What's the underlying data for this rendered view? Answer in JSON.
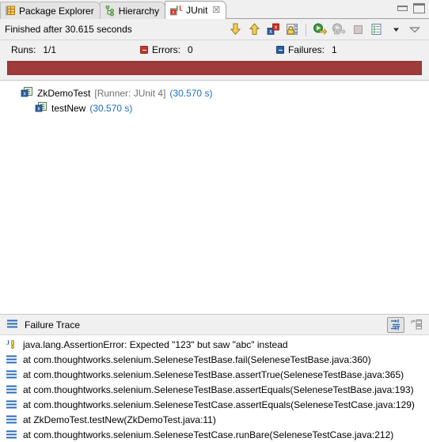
{
  "window": {
    "minimize_label": "Minimize",
    "maximize_label": "Maximize"
  },
  "tabs": [
    {
      "label": "Package Explorer",
      "icon": "package-explorer-icon",
      "active": false,
      "closable": false
    },
    {
      "label": "Hierarchy",
      "icon": "hierarchy-icon",
      "active": false,
      "closable": false
    },
    {
      "label": "JUnit",
      "icon": "junit-icon",
      "active": true,
      "closable": true,
      "close_glyph": "☒"
    }
  ],
  "status": {
    "text": "Finished after 30.615 seconds"
  },
  "toolbar": {
    "items": [
      {
        "name": "next-failure-icon",
        "tooltip": "Next Failed Test"
      },
      {
        "name": "previous-failure-icon",
        "tooltip": "Previous Failed Test"
      },
      {
        "name": "show-failures-only-icon",
        "tooltip": "Show Failures Only"
      },
      {
        "name": "scroll-lock-icon",
        "tooltip": "Scroll Lock"
      },
      {
        "name": "rerun-test-icon",
        "tooltip": "Rerun Test"
      },
      {
        "name": "rerun-failed-tests-icon",
        "tooltip": "Rerun Test - Failures First"
      },
      {
        "name": "stop-icon",
        "tooltip": "Stop JUnit Test Run"
      },
      {
        "name": "test-run-history-icon",
        "tooltip": "Test Run History"
      },
      {
        "name": "history-dropdown-icon",
        "tooltip": "Test Run History Menu"
      },
      {
        "name": "view-menu-icon",
        "tooltip": "View Menu"
      }
    ]
  },
  "counters": {
    "runs": {
      "label": "Runs:",
      "value": "1/1"
    },
    "errors": {
      "label": "Errors:",
      "value": "0",
      "color": "#c0392b"
    },
    "failures": {
      "label": "Failures:",
      "value": "1",
      "color": "#2b5f9e"
    }
  },
  "progress": {
    "percent": 100,
    "color": "#9e3b3b",
    "state": "failed"
  },
  "tree": {
    "nodes": [
      {
        "name": "ZkDemoTest",
        "runner": "[Runner: JUnit 4]",
        "time": "(30.570 s)",
        "icon": "test-class-failed-icon",
        "level": 0
      },
      {
        "name": "testNew",
        "runner": "",
        "time": "(30.570 s)",
        "icon": "test-method-failed-icon",
        "level": 1
      }
    ]
  },
  "failure_trace": {
    "title": "Failure Trace",
    "section_icon": "failure-trace-icon",
    "buttons": [
      {
        "name": "filter-stack-trace-button",
        "pressed": true
      },
      {
        "name": "maximize-trace-button",
        "pressed": false
      }
    ],
    "lines": [
      {
        "icon": "exception-icon",
        "text": "java.lang.AssertionError: Expected \"123\" but saw \"abc\" instead"
      },
      {
        "icon": "stack-frame-icon",
        "text": "at com.thoughtworks.selenium.SeleneseTestBase.fail(SeleneseTestBase.java:360)"
      },
      {
        "icon": "stack-frame-icon",
        "text": "at com.thoughtworks.selenium.SeleneseTestBase.assertTrue(SeleneseTestBase.java:365)"
      },
      {
        "icon": "stack-frame-icon",
        "text": "at com.thoughtworks.selenium.SeleneseTestBase.assertEquals(SeleneseTestBase.java:193)"
      },
      {
        "icon": "stack-frame-icon",
        "text": "at com.thoughtworks.selenium.SeleneseTestCase.assertEquals(SeleneseTestCase.java:129)"
      },
      {
        "icon": "stack-frame-icon",
        "text": "at ZkDemoTest.testNew(ZkDemoTest.java:11)"
      },
      {
        "icon": "stack-frame-icon",
        "text": "at com.thoughtworks.selenium.SeleneseTestCase.runBare(SeleneseTestCase.java:212)"
      }
    ]
  }
}
